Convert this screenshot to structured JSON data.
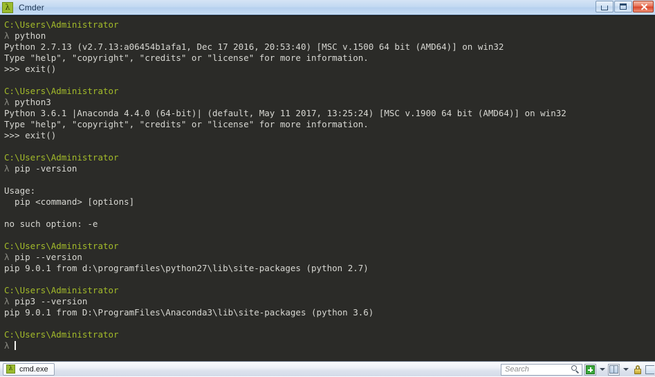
{
  "window": {
    "title": "Cmder",
    "icon": "lambda-icon",
    "controls": {
      "minimize": "Minimize",
      "maximize": "Maximize",
      "close": "Close"
    }
  },
  "terminal": {
    "lines": [
      {
        "type": "path",
        "text": "C:\\Users\\Administrator"
      },
      {
        "type": "prompt",
        "prompt": "λ ",
        "text": "python"
      },
      {
        "type": "out",
        "text": "Python 2.7.13 (v2.7.13:a06454b1afa1, Dec 17 2016, 20:53:40) [MSC v.1500 64 bit (AMD64)] on win32"
      },
      {
        "type": "out",
        "text": "Type \"help\", \"copyright\", \"credits\" or \"license\" for more information."
      },
      {
        "type": "out",
        "text": ">>> exit()"
      },
      {
        "type": "blank",
        "text": ""
      },
      {
        "type": "path",
        "text": "C:\\Users\\Administrator"
      },
      {
        "type": "prompt",
        "prompt": "λ ",
        "text": "python3"
      },
      {
        "type": "out",
        "text": "Python 3.6.1 |Anaconda 4.4.0 (64-bit)| (default, May 11 2017, 13:25:24) [MSC v.1900 64 bit (AMD64)] on win32"
      },
      {
        "type": "out",
        "text": "Type \"help\", \"copyright\", \"credits\" or \"license\" for more information."
      },
      {
        "type": "out",
        "text": ">>> exit()"
      },
      {
        "type": "blank",
        "text": ""
      },
      {
        "type": "path",
        "text": "C:\\Users\\Administrator"
      },
      {
        "type": "prompt",
        "prompt": "λ ",
        "text": "pip -version"
      },
      {
        "type": "blank",
        "text": ""
      },
      {
        "type": "out",
        "text": "Usage:"
      },
      {
        "type": "out",
        "text": "  pip <command> [options]"
      },
      {
        "type": "blank",
        "text": ""
      },
      {
        "type": "out",
        "text": "no such option: -e"
      },
      {
        "type": "blank",
        "text": ""
      },
      {
        "type": "path",
        "text": "C:\\Users\\Administrator"
      },
      {
        "type": "prompt",
        "prompt": "λ ",
        "text": "pip --version"
      },
      {
        "type": "out",
        "text": "pip 9.0.1 from d:\\programfiles\\python27\\lib\\site-packages (python 2.7)"
      },
      {
        "type": "blank",
        "text": ""
      },
      {
        "type": "path",
        "text": "C:\\Users\\Administrator"
      },
      {
        "type": "prompt",
        "prompt": "λ ",
        "text": "pip3 --version"
      },
      {
        "type": "out",
        "text": "pip 9.0.1 from D:\\ProgramFiles\\Anaconda3\\lib\\site-packages (python 3.6)"
      },
      {
        "type": "blank",
        "text": ""
      },
      {
        "type": "path",
        "text": "C:\\Users\\Administrator"
      },
      {
        "type": "cursor",
        "prompt": "λ ",
        "text": ""
      }
    ],
    "colors": {
      "background": "#2b2b28",
      "path": "#a3bb2a",
      "prompt": "#8a8a82",
      "output": "#d7d7d2",
      "cursor": "#f2f2ee"
    }
  },
  "statusbar": {
    "tab": {
      "label": "cmd.exe",
      "icon": "lambda-icon"
    },
    "search": {
      "placeholder": "Search",
      "value": "",
      "icon": "search-icon"
    },
    "buttons": {
      "new_console": "new-console-button",
      "new_console_menu": "new-console-dropdown",
      "split_pane": "split-pane-button",
      "split_pane_menu": "split-pane-dropdown",
      "lock": "lock-button",
      "extra": "edge-button"
    }
  }
}
